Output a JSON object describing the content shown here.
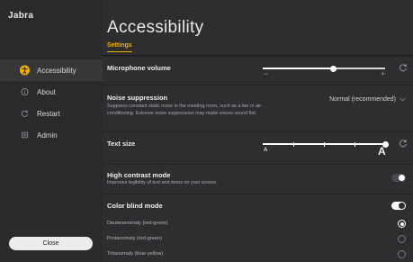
{
  "app": {
    "brand": "Jabra"
  },
  "sidebar": {
    "items": [
      {
        "label": "Accessibility",
        "icon": "accessibility-icon",
        "active": true
      },
      {
        "label": "About",
        "icon": "info-icon",
        "active": false
      },
      {
        "label": "Restart",
        "icon": "restart-icon",
        "active": false
      },
      {
        "label": "Admin",
        "icon": "admin-icon",
        "active": false
      }
    ],
    "close_label": "Close"
  },
  "header": {
    "title": "Accessibility",
    "tab": "Settings"
  },
  "settings": {
    "microphone_volume": {
      "title": "Microphone volume",
      "minus": "−",
      "plus": "+",
      "value_fraction": 0.58
    },
    "noise_suppression": {
      "title": "Noise suppression",
      "description": "Suppress constant static noise in the meeting room, such as a fan or air conditioning. Extreme noise suppression may make voices sound flat.",
      "value": "Normal (recommended)"
    },
    "text_size": {
      "title": "Text size",
      "small_label": "A",
      "large_label": "A",
      "steps": 4,
      "selected_step": 4
    },
    "high_contrast": {
      "title": "High contrast mode",
      "description": "Improves legibility of text and items on your screen.",
      "enabled": false
    },
    "color_blind": {
      "title": "Color blind mode",
      "enabled": true,
      "options": [
        {
          "label": "Deuteranomaly (red-green)",
          "selected": true
        },
        {
          "label": "Protanomaly (red-green)",
          "selected": false
        },
        {
          "label": "Tritanomaly (blue-yellow)",
          "selected": false
        }
      ]
    }
  },
  "colors": {
    "accent": "#f2b100",
    "sidebar_bg": "#2a2a2c",
    "main_bg": "#2e2e31"
  }
}
